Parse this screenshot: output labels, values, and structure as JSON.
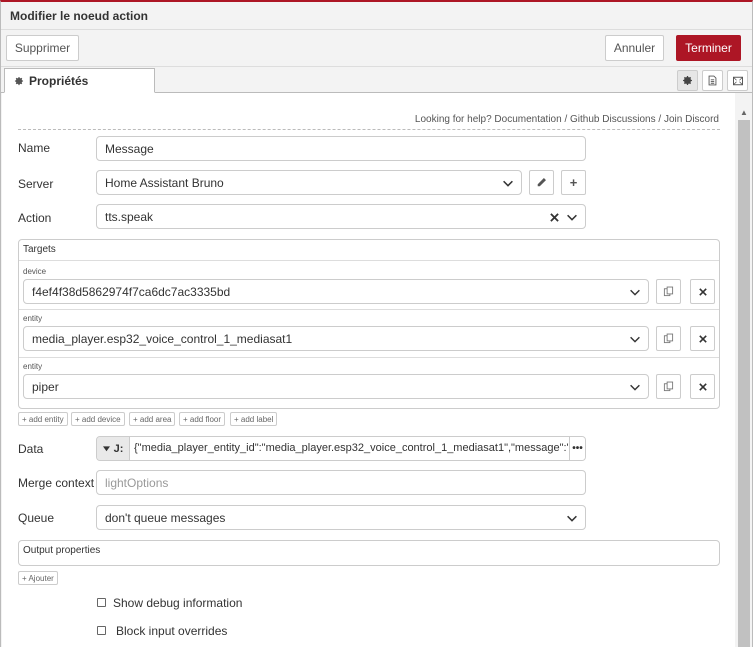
{
  "tray": {
    "title": "Modifier le noeud action",
    "delete_label": "Supprimer",
    "cancel_label": "Annuler",
    "done_label": "Terminer"
  },
  "tabs": {
    "properties_label": "Propriétés"
  },
  "help": {
    "prefix": "Looking for help?",
    "links": [
      "Documentation",
      "Github Discussions",
      "Join Discord"
    ],
    "separator": "/"
  },
  "form": {
    "name_label": "Name",
    "name_value": "Message",
    "server_label": "Server",
    "server_value": "Home Assistant Bruno",
    "action_label": "Action",
    "action_value": "tts.speak",
    "targets_title": "Targets",
    "targets": [
      {
        "kind": "device",
        "value": "f4ef4f38d5862974f7ca6dc7ac3335bd"
      },
      {
        "kind": "entity",
        "value": "media_player.esp32_voice_control_1_mediasat1"
      },
      {
        "kind": "entity",
        "value": "piper"
      }
    ],
    "add_buttons": [
      "+ add entity",
      "+ add device",
      "+ add area",
      "+ add floor",
      "+ add label"
    ],
    "data_label": "Data",
    "data_type": "J:",
    "data_value": "{\"media_player_entity_id\":\"media_player.esp32_voice_control_1_mediasat1\",\"message\":\"Vous",
    "merge_label": "Merge context",
    "merge_placeholder": "lightOptions",
    "queue_label": "Queue",
    "queue_value": "don't queue messages",
    "output_title": "Output properties",
    "add_output_label": "+ Ajouter",
    "debug_label": "Show debug information",
    "block_label": "Block input overrides"
  },
  "colors": {
    "accent": "#ad1625"
  }
}
